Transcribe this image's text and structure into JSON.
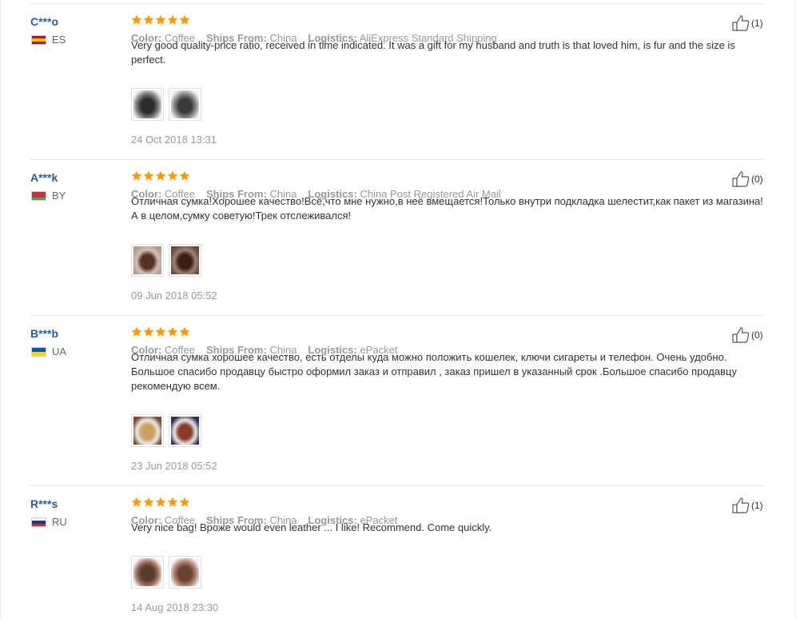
{
  "reviews": [
    {
      "user": "C***o",
      "country_code": "ES",
      "flag_colors": [
        "#c60b1e",
        "#ffc400",
        "#c60b1e"
      ],
      "rating": 5,
      "color_label": "Color:",
      "color_value": "Coffee",
      "ships_label": "Ships From:",
      "ships_value": "China",
      "logistics_label": "Logistics:",
      "logistics_value": "AliExpress Standard Shipping",
      "text": "Very good quality-price ratio, received in time indicated. It was a gift for my husband and truth is that loved him, is fur and the size is perfect.",
      "photos": [
        "photo-1",
        "photo-2"
      ],
      "date": "24 Oct 2018 13:31",
      "helpful": "(1)"
    },
    {
      "user": "A***k",
      "country_code": "BY",
      "flag_colors": [
        "#c8313e",
        "#c8313e",
        "#4aa657"
      ],
      "rating": 5,
      "color_label": "Color:",
      "color_value": "Coffee",
      "ships_label": "Ships From:",
      "ships_value": "China",
      "logistics_label": "Logistics:",
      "logistics_value": "China Post Registered Air Mail",
      "text": "Отличная сумка!Хорошее качество!Всё,что мне нужно,в неё вмещается!Только внутри подкладка шелестит,как пакет из магазина!А в целом,сумку советую!Трек отслеживался!",
      "photos": [
        "photo-1",
        "photo-2"
      ],
      "date": "09 Jun 2018 05:52",
      "helpful": "(0)"
    },
    {
      "user": "B***b",
      "country_code": "UA",
      "flag_colors": [
        "#0057b7",
        "#ffd700"
      ],
      "rating": 5,
      "color_label": "Color:",
      "color_value": "Coffee",
      "ships_label": "Ships From:",
      "ships_value": "China",
      "logistics_label": "Logistics:",
      "logistics_value": "ePacket",
      "text": "Отличная сумка хорошее качество, есть отделы куда можно положить кошелек, ключи сигареты и телефон. Очень удобно. Большое спасибо продавцу быстро оформил заказ и отправил , заказ пришел в указанный срок .Большое спасибо продавцу рекомендую всем.",
      "photos": [
        "photo-1",
        "photo-2"
      ],
      "date": "23 Jun 2018 05:52",
      "helpful": "(0)"
    },
    {
      "user": "R***s",
      "country_code": "RU",
      "flag_colors": [
        "#ffffff",
        "#0039a6",
        "#d52b1e"
      ],
      "rating": 5,
      "color_label": "Color:",
      "color_value": "Coffee",
      "ships_label": "Ships From:",
      "ships_value": "China",
      "logistics_label": "Logistics:",
      "logistics_value": "ePacket",
      "text": "Very nice bag! Вроже would even leather ... I like! Recommend. Come quickly.",
      "photos": [
        "photo-1",
        "photo-2"
      ],
      "date": "14 Aug 2018 23:30",
      "helpful": "(1)"
    }
  ],
  "colors": {
    "username": "#2a5d9e",
    "star": "#ff9a00",
    "muted": "#999999"
  }
}
